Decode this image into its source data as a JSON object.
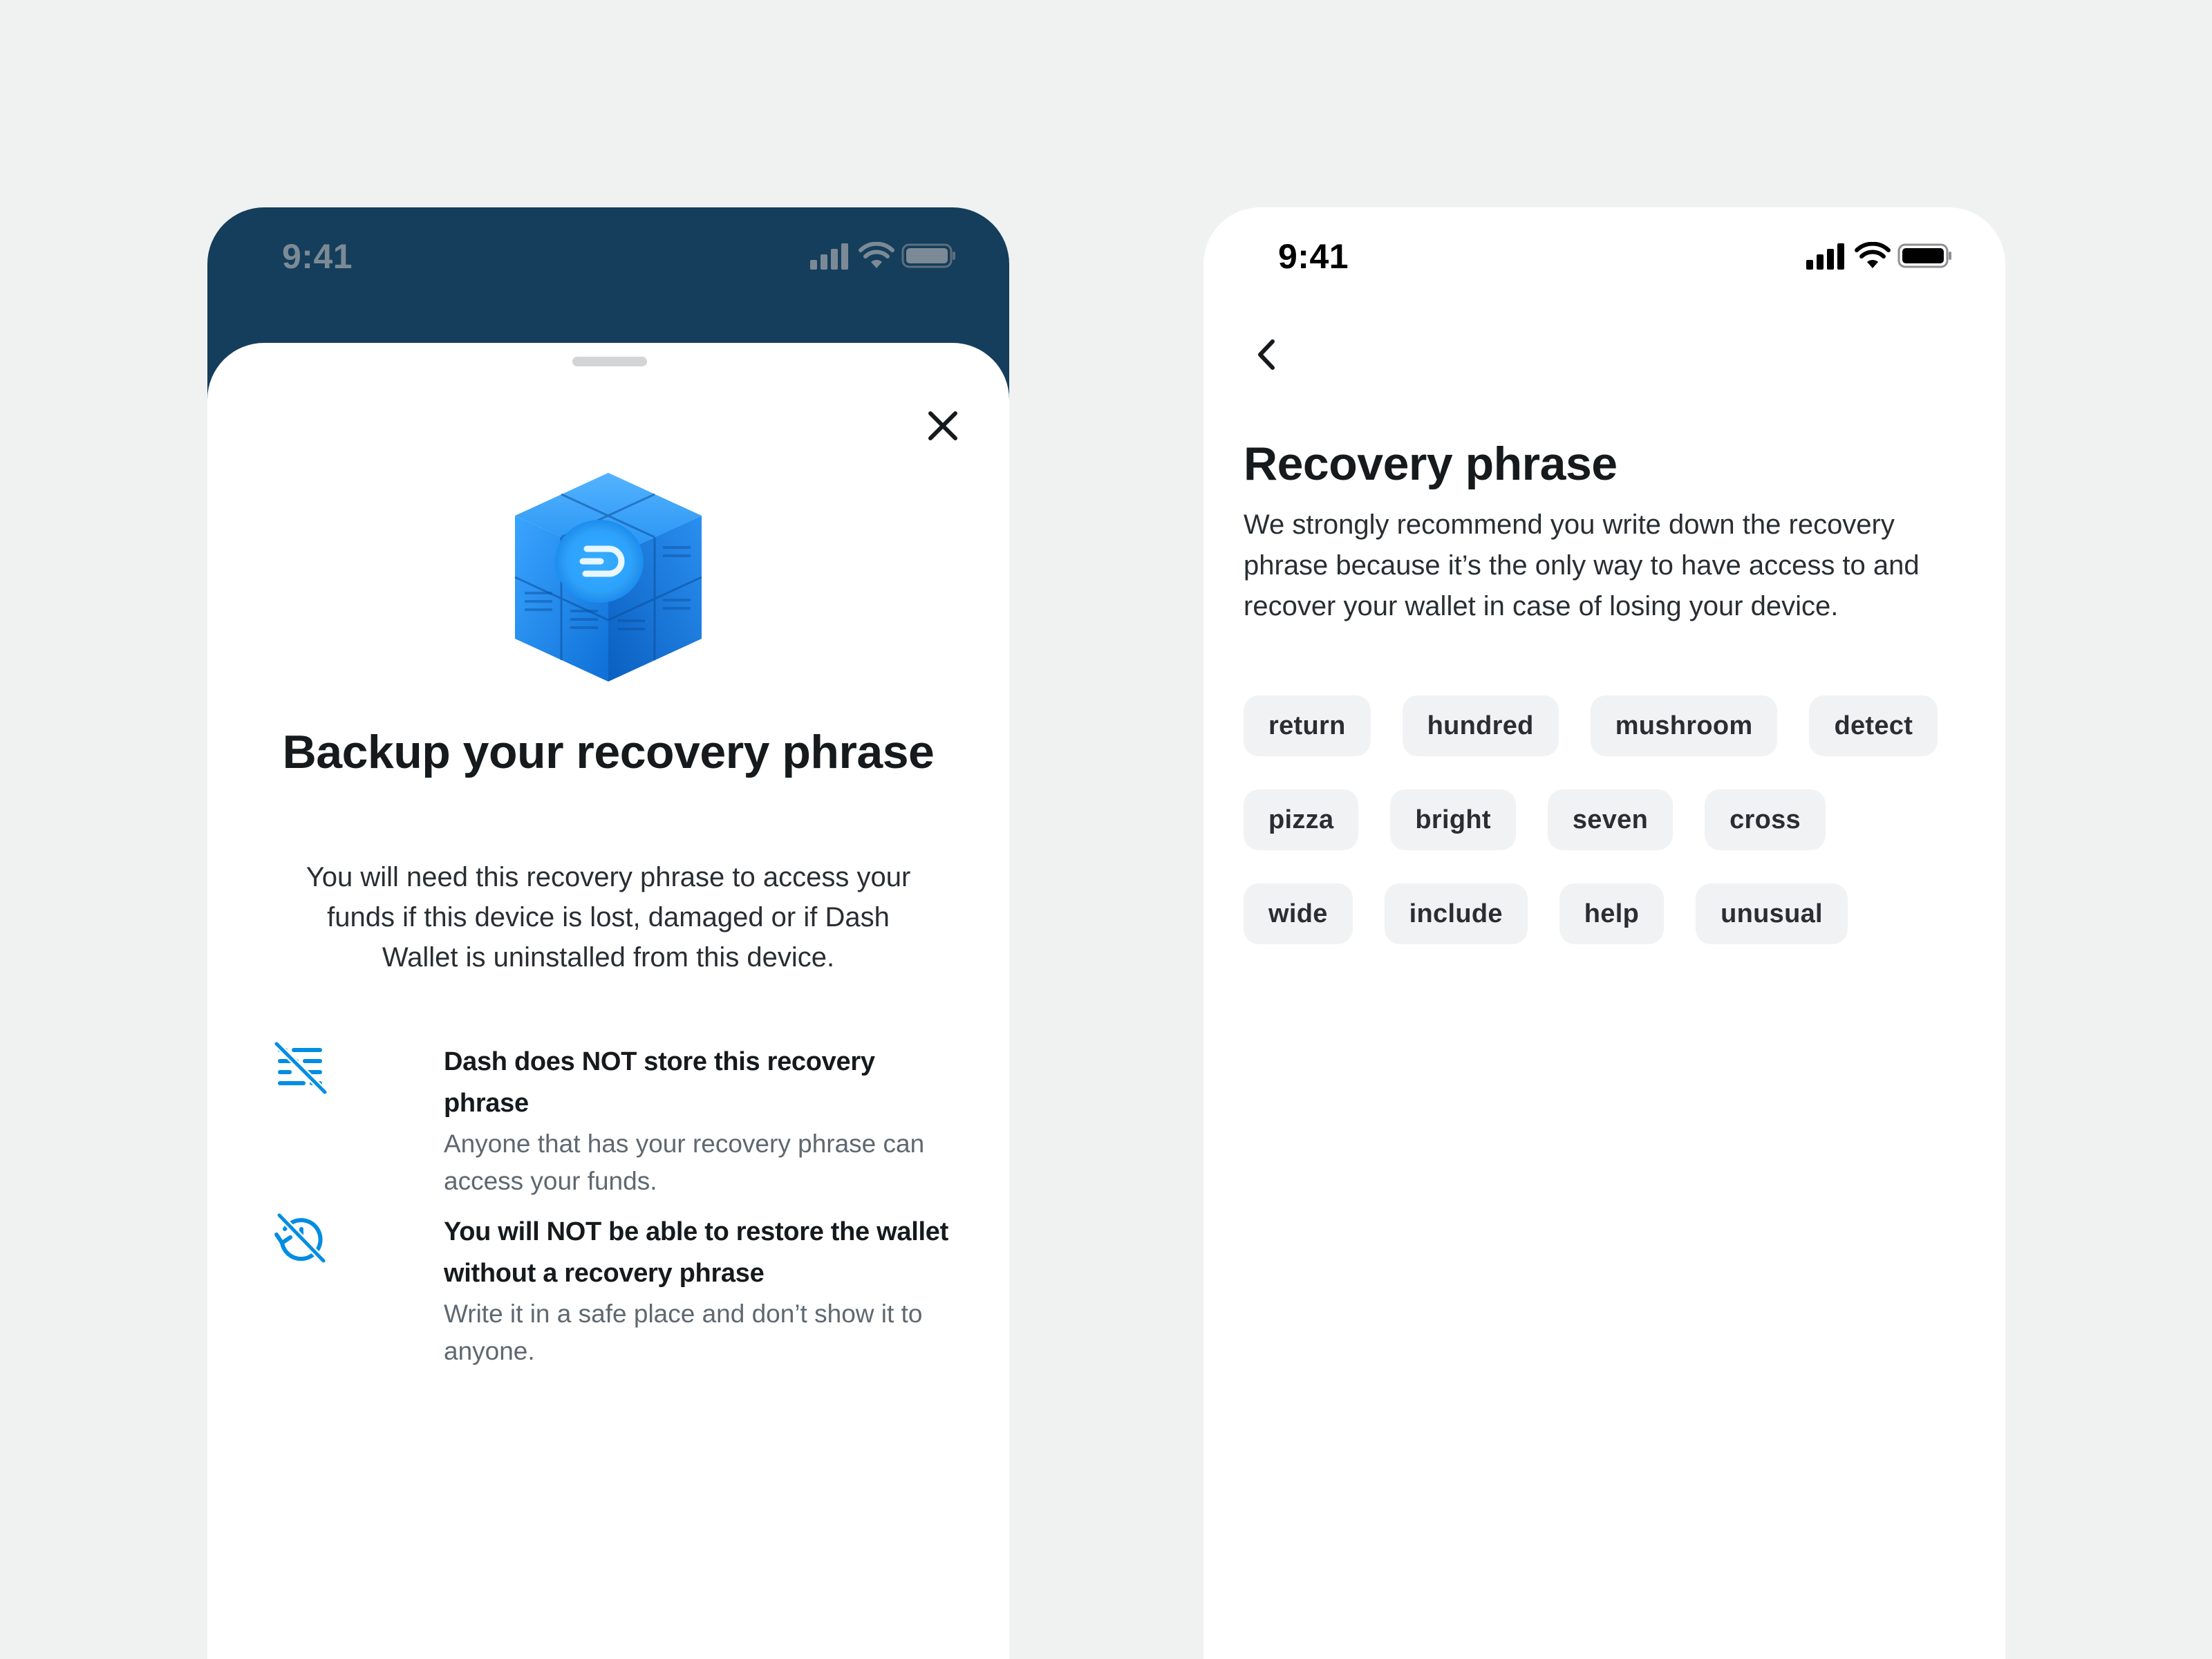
{
  "colors": {
    "page_background": "#f0f1f1",
    "header_navy": "#143e5b",
    "accent_blue": "#008de4",
    "chip_background": "#f1f2f4"
  },
  "left_screen": {
    "status_bar": {
      "time": "9:41"
    },
    "close_icon": "close-icon",
    "illustration": "cube-illustration",
    "title": "Backup your recovery phrase",
    "description": "You will need this recovery phrase to access your funds if this device is lost, damaged or if Dash Wallet is uninstalled from this device.",
    "features": [
      {
        "icon": "no-storage-icon",
        "title": "Dash does NOT store this recovery phrase",
        "subtitle": "Anyone that has your recovery phrase can access your funds."
      },
      {
        "icon": "no-restore-icon",
        "title": "You will NOT be able to restore the wallet without a recovery phrase",
        "subtitle": "Write it in a safe place and don’t show it to anyone."
      }
    ]
  },
  "right_screen": {
    "status_bar": {
      "time": "9:41"
    },
    "back_icon": "chevron-left-icon",
    "title": "Recovery phrase",
    "description": "We strongly recommend you write down the recovery phrase because it’s the only way to have access to and recover your wallet in case of losing your device.",
    "words": [
      [
        "return",
        "hundred",
        "mushroom",
        "detect"
      ],
      [
        "pizza",
        "bright",
        "seven",
        "cross"
      ],
      [
        "wide",
        "include",
        "help",
        "unusual"
      ]
    ]
  }
}
